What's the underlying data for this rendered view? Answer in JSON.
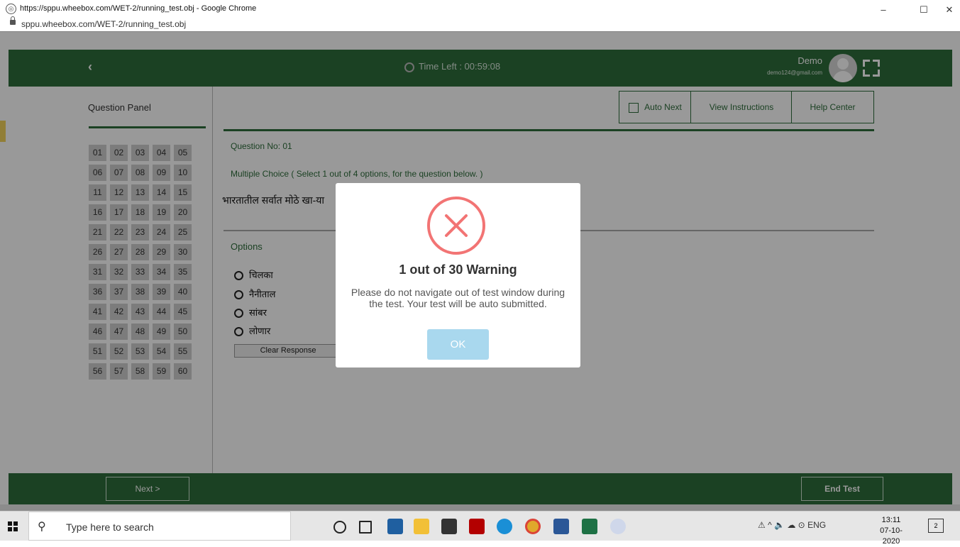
{
  "browser": {
    "window_title": "https://sppu.wheebox.com/WET-2/running_test.obj - Google Chrome",
    "address": "sppu.wheebox.com/WET-2/running_test.obj",
    "minimize": "–",
    "maximize": "☐",
    "close": "✕"
  },
  "header": {
    "back": "‹",
    "time_left": "Time Left :  00:59:08",
    "user_name": "Demo",
    "user_email": "demo124@gmail.com"
  },
  "question_panel": {
    "title": "Question Panel",
    "numbers": [
      "01",
      "02",
      "03",
      "04",
      "05",
      "06",
      "07",
      "08",
      "09",
      "10",
      "11",
      "12",
      "13",
      "14",
      "15",
      "16",
      "17",
      "18",
      "19",
      "20",
      "21",
      "22",
      "23",
      "24",
      "25",
      "26",
      "27",
      "28",
      "29",
      "30",
      "31",
      "32",
      "33",
      "34",
      "35",
      "36",
      "37",
      "38",
      "39",
      "40",
      "41",
      "42",
      "43",
      "44",
      "45",
      "46",
      "47",
      "48",
      "49",
      "50",
      "51",
      "52",
      "53",
      "54",
      "55",
      "56",
      "57",
      "58",
      "59",
      "60"
    ]
  },
  "toolbar": {
    "auto_next": "Auto Next",
    "view_instructions": "View Instructions",
    "help_center": "Help Center"
  },
  "question": {
    "number": "Question No: 01",
    "type": "Multiple Choice ( Select 1 out of 4 options, for the question below. )",
    "text": "भारतातील सर्वात मोठे खा-या",
    "options_label": "Options",
    "options": [
      "चिलका",
      "नैनीताल",
      "सांबर",
      "लोणार"
    ],
    "clear_response": "Clear Response"
  },
  "footer": {
    "next": "Next >",
    "end_test": "End Test"
  },
  "modal": {
    "title": "1 out of 30 Warning",
    "message": "Please do not navigate out of test window during the test. Your test will be auto submitted.",
    "ok": "OK",
    "icon_color": "#f27474"
  },
  "taskbar": {
    "search_placeholder": "Type here to search",
    "language": "ENG",
    "time": "13:11",
    "date": "07-10-2020",
    "notifications": "2"
  },
  "colors": {
    "brand_green": "#2e6d3b",
    "ok_button": "#a9d8ee"
  }
}
